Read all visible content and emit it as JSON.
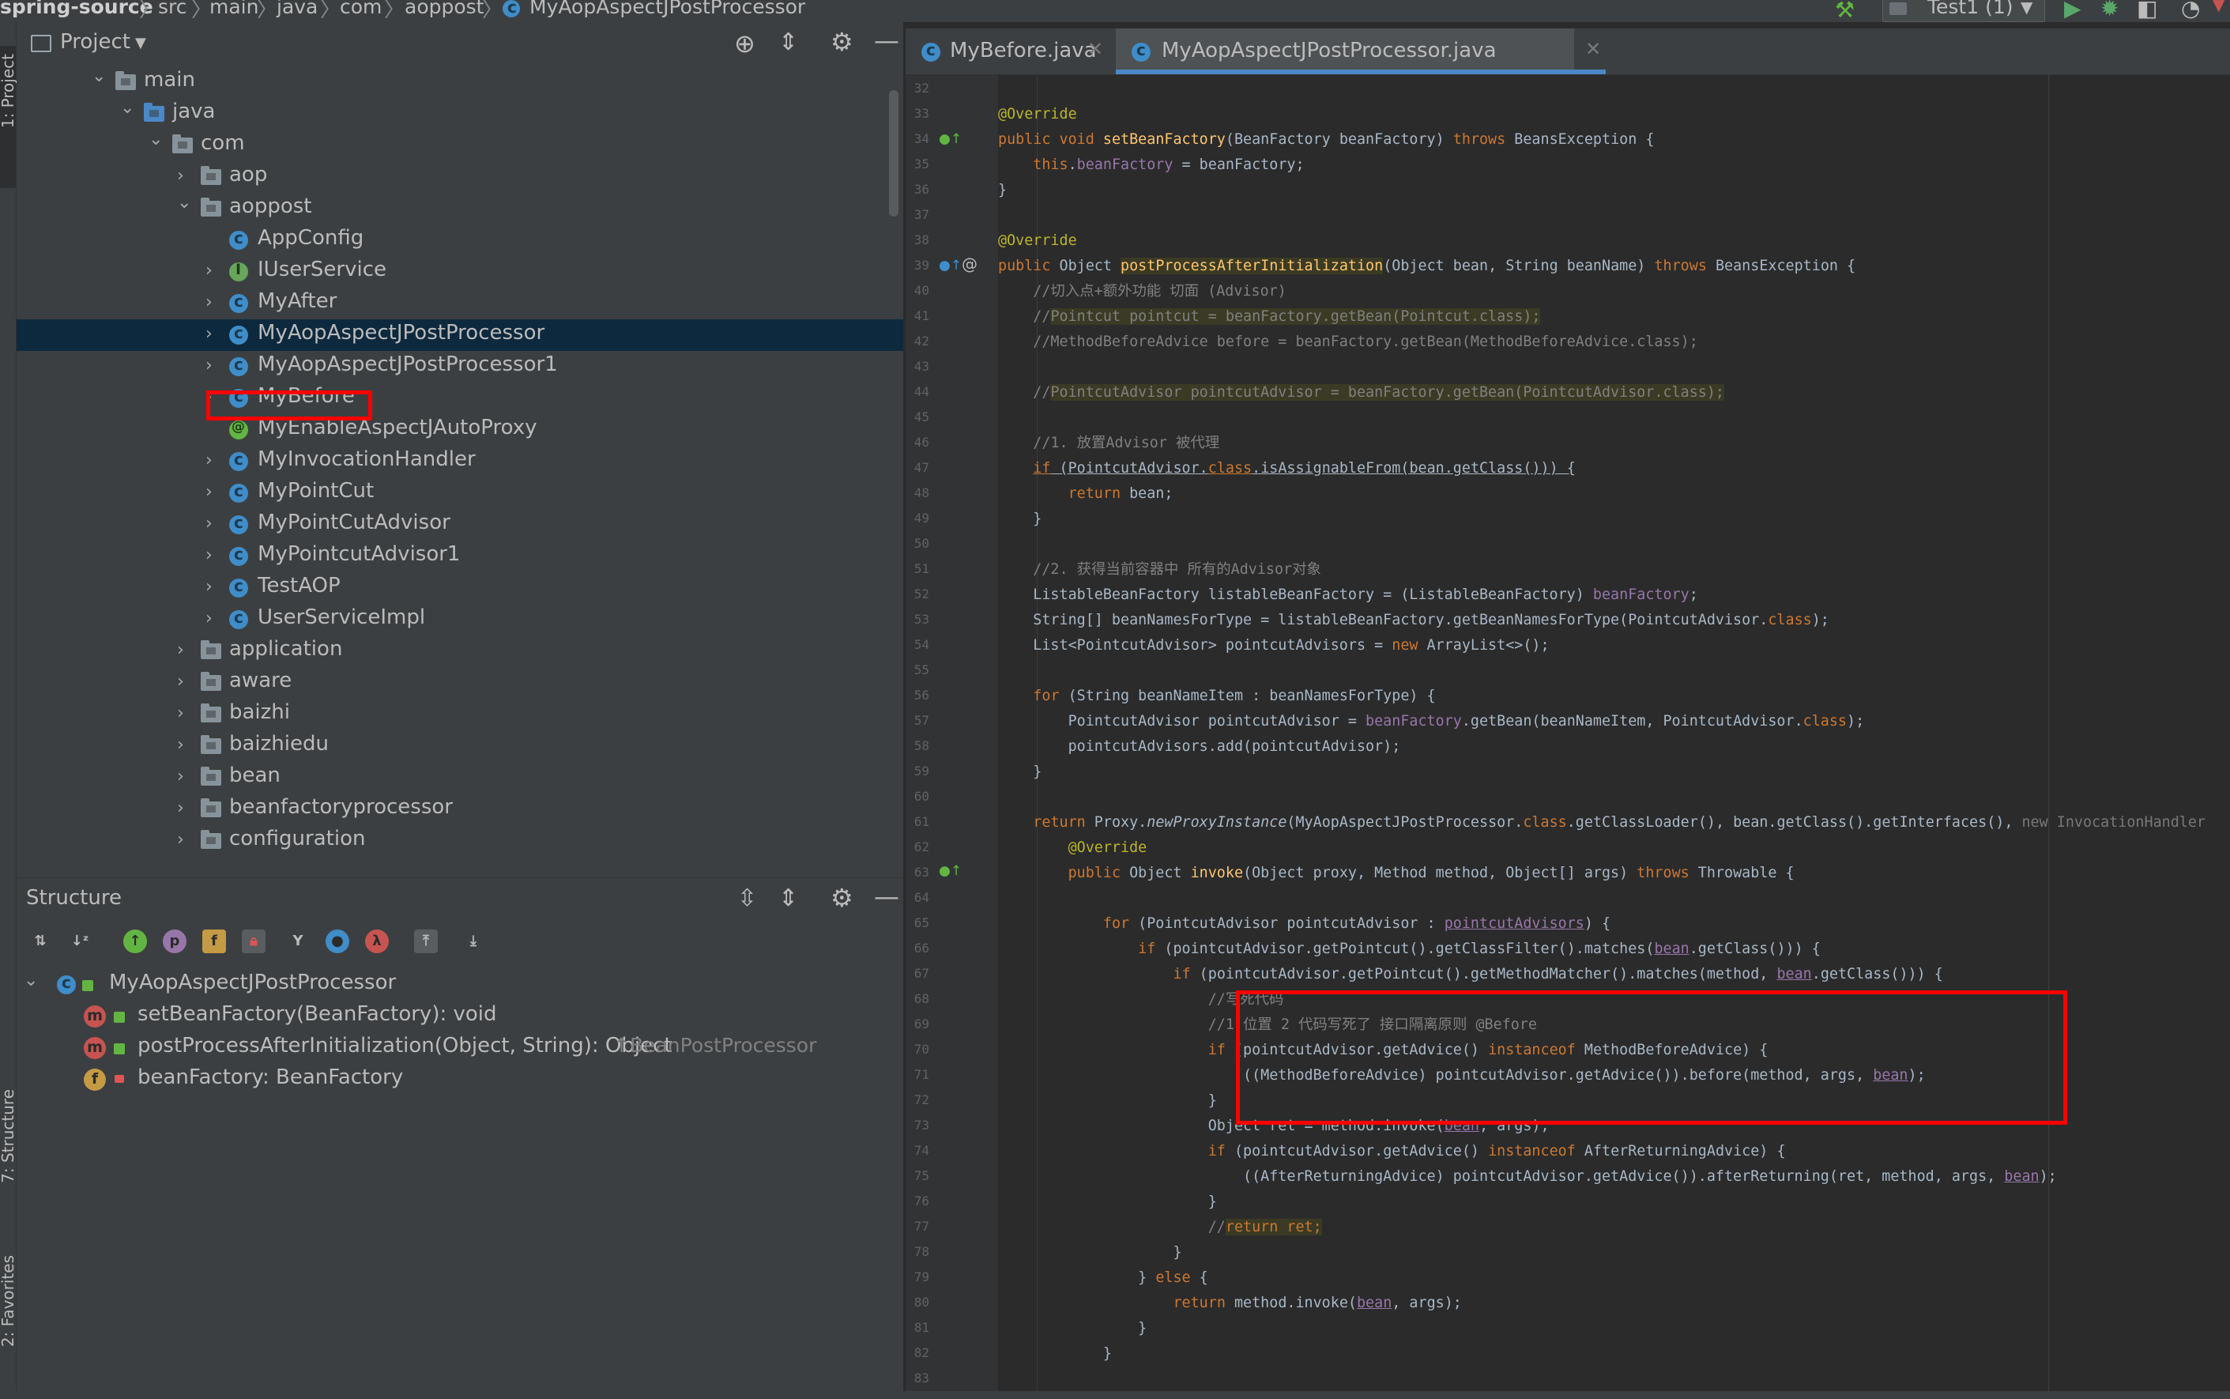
{
  "breadcrumb": {
    "items": [
      "spring-source",
      "src",
      "main",
      "java",
      "com",
      "aoppost",
      "MyAopAspectJPostProcessor"
    ]
  },
  "toolbar": {
    "run_config": "Test1 (1)"
  },
  "left_stripe": {
    "project_tab": "1: Project",
    "structure_tab": "7: Structure",
    "favorites_tab": "2: Favorites"
  },
  "project_panel": {
    "title": "Project",
    "tree": [
      {
        "label": "main",
        "type": "folder",
        "depth": 0,
        "expanded": true
      },
      {
        "label": "java",
        "type": "folder-src",
        "depth": 1,
        "expanded": true
      },
      {
        "label": "com",
        "type": "folder",
        "depth": 2,
        "expanded": true
      },
      {
        "label": "aop",
        "type": "folder",
        "depth": 3,
        "expanded": false
      },
      {
        "label": "aoppost",
        "type": "folder",
        "depth": 3,
        "expanded": true
      },
      {
        "label": "AppConfig",
        "type": "class",
        "depth": 4,
        "expanded": null
      },
      {
        "label": "IUserService",
        "type": "interface",
        "depth": 4,
        "expanded": false
      },
      {
        "label": "MyAfter",
        "type": "class",
        "depth": 4,
        "expanded": false
      },
      {
        "label": "MyAopAspectJPostProcessor",
        "type": "class",
        "depth": 4,
        "expanded": false,
        "selected": true
      },
      {
        "label": "MyAopAspectJPostProcessor1",
        "type": "class",
        "depth": 4,
        "expanded": false
      },
      {
        "label": "MyBefore",
        "type": "class",
        "depth": 4,
        "expanded": false
      },
      {
        "label": "MyEnableAspectJAutoProxy",
        "type": "annotation",
        "depth": 4,
        "expanded": null
      },
      {
        "label": "MyInvocationHandler",
        "type": "class",
        "depth": 4,
        "expanded": false
      },
      {
        "label": "MyPointCut",
        "type": "class",
        "depth": 4,
        "expanded": false
      },
      {
        "label": "MyPointCutAdvisor",
        "type": "class",
        "depth": 4,
        "expanded": false
      },
      {
        "label": "MyPointcutAdvisor1",
        "type": "class",
        "depth": 4,
        "expanded": false
      },
      {
        "label": "TestAOP",
        "type": "class",
        "depth": 4,
        "expanded": false
      },
      {
        "label": "UserServiceImpl",
        "type": "class",
        "depth": 4,
        "expanded": false
      },
      {
        "label": "application",
        "type": "folder",
        "depth": 3,
        "expanded": false
      },
      {
        "label": "aware",
        "type": "folder",
        "depth": 3,
        "expanded": false
      },
      {
        "label": "baizhi",
        "type": "folder",
        "depth": 3,
        "expanded": false
      },
      {
        "label": "baizhiedu",
        "type": "folder",
        "depth": 3,
        "expanded": false
      },
      {
        "label": "bean",
        "type": "folder",
        "depth": 3,
        "expanded": false
      },
      {
        "label": "beanfactoryprocessor",
        "type": "folder",
        "depth": 3,
        "expanded": false
      },
      {
        "label": "configuration",
        "type": "folder",
        "depth": 3,
        "expanded": false
      }
    ]
  },
  "structure_panel": {
    "title": "Structure",
    "toolbar_icons": [
      "sort-visibility-icon",
      "sort-alpha-icon",
      "inherited-icon",
      "properties-icon",
      "fields-icon",
      "non-public-icon",
      "anonymous-icon",
      "lambda-icon",
      "expand-icon",
      "autoscroll-icon",
      "autoscroll-from-icon"
    ],
    "root": "MyAopAspectJPostProcessor",
    "members": [
      {
        "kind": "m",
        "label": "setBeanFactory(BeanFactory): void",
        "suffix": ""
      },
      {
        "kind": "m",
        "label": "postProcessAfterInitialization(Object, String): Object",
        "suffix": "↑BeanPostProcessor"
      },
      {
        "kind": "f",
        "label": "beanFactory: BeanFactory",
        "suffix": ""
      }
    ]
  },
  "editor": {
    "tabs": [
      {
        "label": "MyBefore.java",
        "active": false
      },
      {
        "label": "MyAopAspectJPostProcessor.java",
        "active": true
      }
    ],
    "line_numbers": [
      "32",
      "33",
      "34",
      "35",
      "36",
      "37",
      "38",
      "39",
      "40",
      "41",
      "42",
      "43",
      "44",
      "45",
      "46",
      "47",
      "48",
      "49",
      "50",
      "51",
      "52",
      "53",
      "54",
      "55",
      "56",
      "57",
      "58",
      "59",
      "60",
      "61",
      "62",
      "63",
      "64",
      "65",
      "66",
      "67",
      "68",
      "69",
      "70",
      "71",
      "72",
      "73",
      "74",
      "75",
      "76",
      "77",
      "78",
      "79",
      "80",
      "81",
      "82",
      "83"
    ],
    "code": {
      "l33": "@Override",
      "l34a": "public void ",
      "l34b": "setBeanFactory",
      "l34c": "(BeanFactory beanFactory) ",
      "l34d": "throws",
      "l34e": " BeansException {",
      "l35a": "    this",
      "l35b": ".",
      "l35c": "beanFactory",
      "l35d": " = beanFactory;",
      "l36": "}",
      "l38": "@Override",
      "l39a": "public ",
      "l39b": "Object ",
      "l39c": "postProcessAfterInitialization",
      "l39d": "(Object bean, String beanName) ",
      "l39e": "throws",
      "l39f": " BeansException {",
      "l40": "    //切入点+额外功能 切面 (Advisor)",
      "l41a": "    //",
      "l41b": "Pointcut pointcut = beanFactory.getBean(Pointcut.class);",
      "l42": "    //MethodBeforeAdvice before = beanFactory.getBean(MethodBeforeAdvice.class);",
      "l44a": "    //",
      "l44b": "PointcutAdvisor pointcutAdvisor = beanFactory.getBean(PointcutAdvisor.class);",
      "l46": "    //1. 放置Advisor 被代理",
      "l47a": "    ",
      "l47b": "if",
      "l47c": " (PointcutAdvisor.",
      "l47d": "class",
      "l47e": ".isAssignableFrom(bean.getClass())) {",
      "l48a": "        ",
      "l48b": "return",
      "l48c": " bean;",
      "l49": "    }",
      "l51": "    //2. 获得当前容器中 所有的Advisor对象",
      "l52a": "    ListableBeanFactory listableBeanFactory = (ListableBeanFactory) ",
      "l52b": "beanFactory",
      "l52c": ";",
      "l53a": "    String[] beanNamesForType = listableBeanFactory.getBeanNamesForType(PointcutAdvisor.",
      "l53b": "class",
      "l53c": ");",
      "l54a": "    List<PointcutAdvisor> pointcutAdvisors = ",
      "l54b": "new",
      "l54c": " ArrayList<>();",
      "l56a": "    ",
      "l56b": "for",
      "l56c": " (String beanNameItem : beanNamesForType) {",
      "l57a": "        PointcutAdvisor pointcutAdvisor = ",
      "l57b": "beanFactory",
      "l57c": ".getBean(beanNameItem, PointcutAdvisor.",
      "l57d": "class",
      "l57e": ");",
      "l58": "        pointcutAdvisors.add(pointcutAdvisor);",
      "l59": "    }",
      "l61a": "    ",
      "l61b": "return",
      "l61c": " Proxy.",
      "l61d": "newProxyInstance",
      "l61e": "(MyAopAspectJPostProcessor.",
      "l61f": "class",
      "l61g": ".getClassLoader(), bean.getClass().getInterfaces(), ",
      "l61h": "new InvocationHandler",
      "l62": "        @Override",
      "l63a": "        ",
      "l63b": "public",
      "l63c": " Object ",
      "l63d": "invoke",
      "l63e": "(Object proxy, Method method, Object[] args) ",
      "l63f": "throws",
      "l63g": " Throwable {",
      "l65a": "            ",
      "l65b": "for",
      "l65c": " (PointcutAdvisor pointcutAdvisor : ",
      "l65d": "pointcutAdvisors",
      "l65e": ") {",
      "l66a": "                ",
      "l66b": "if",
      "l66c": " (pointcutAdvisor.getPointcut().getClassFilter().matches(",
      "l66d": "bean",
      "l66e": ".getClass())) {",
      "l67a": "                    ",
      "l67b": "if",
      "l67c": " (pointcutAdvisor.getPointcut().getMethodMatcher().matches(method, ",
      "l67d": "bean",
      "l67e": ".getClass())) {",
      "l68": "                        //写死代码",
      "l69": "                        //1 位置 2 代码写死了 接口隔离原则 @Before",
      "l70a": "                        ",
      "l70b": "if",
      "l70c": " (pointcutAdvisor.getAdvice() ",
      "l70d": "instanceof",
      "l70e": " MethodBeforeAdvice) {",
      "l71a": "                            ((MethodBeforeAdvice) pointcutAdvisor.getAdvice()).before(method, args, ",
      "l71b": "bean",
      "l71c": ");",
      "l72": "                        }",
      "l73a": "                        Object ret = method.invoke(",
      "l73b": "bean",
      "l73c": ", args);",
      "l74a": "                        ",
      "l74b": "if",
      "l74c": " (pointcutAdvisor.getAdvice() ",
      "l74d": "instanceof",
      "l74e": " AfterReturningAdvice) {",
      "l75a": "                            ((AfterReturningAdvice) pointcutAdvisor.getAdvice()).afterReturning(ret, method, args, ",
      "l75b": "bean",
      "l75c": ");",
      "l76": "                        }",
      "l77a": "                        //",
      "l77b": "return ret;",
      "l78": "                    }",
      "l79a": "                } ",
      "l79b": "else",
      "l79c": " {",
      "l80a": "                    ",
      "l80b": "return",
      "l80c": " method.invoke(",
      "l80d": "bean",
      "l80e": ", args);",
      "l81": "                }",
      "l82": "            }"
    }
  },
  "colors": {
    "editor_bg": "#2b2b2b",
    "panel_bg": "#3c3f41",
    "selection": "#0d293e",
    "accent_tab": "#4a88c7",
    "annotation_red": "#ff0000"
  }
}
